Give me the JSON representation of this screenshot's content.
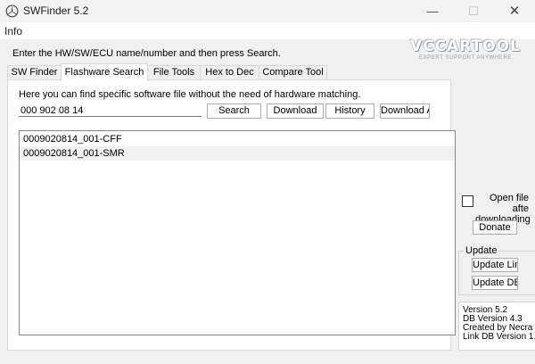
{
  "window": {
    "title": "SWFinder 5.2",
    "min_glyph": "—",
    "max_glyph": "☐",
    "close_glyph": "✕",
    "app_icon": "mercedes-star-icon"
  },
  "menu": {
    "items": [
      "Info"
    ]
  },
  "instruction": "Enter the HW/SW/ECU name/number and then press Search.",
  "logo": {
    "main": "VCCARTOOL",
    "tagline": "EXPERT SUPPORT ANYWHERE"
  },
  "tabs": [
    {
      "label": "SW Finder"
    },
    {
      "label": "Flashware Search",
      "active": true
    },
    {
      "label": "File Tools"
    },
    {
      "label": "Hex to Dec"
    },
    {
      "label": "Compare Tool"
    }
  ],
  "flashware": {
    "description": "Here you can find specific software file without the need of hardware matching.",
    "query": "000 902 08 14",
    "buttons": {
      "search": "Search",
      "download": "Download",
      "history": "History",
      "download_all": "Download ALL"
    },
    "results": [
      "0009020814_001-CFF",
      "0009020814_001-SMR"
    ]
  },
  "sidebar": {
    "open_after_label_line1": "Open file afte",
    "open_after_label_line2": "downloading",
    "open_after_checked": false,
    "donate": "Donate",
    "update_group": "Update",
    "update_links": "Update Links",
    "update_db": "Update DB",
    "info": [
      "Version 5.2",
      "DB Version 4.3",
      "Created by Necra",
      "Link DB Version 1."
    ]
  }
}
